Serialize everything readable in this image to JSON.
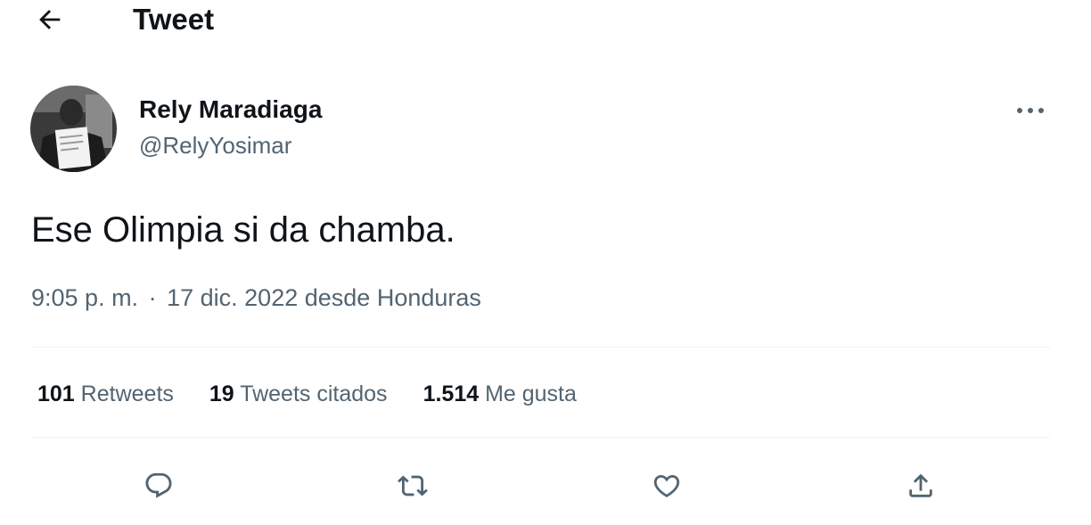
{
  "header": {
    "title": "Tweet",
    "back_icon": "arrow-left-icon"
  },
  "author": {
    "display_name": "Rely Maradiaga",
    "handle": "@RelyYosimar",
    "avatar": "profile-photo"
  },
  "tweet": {
    "text": "Ese Olimpia si da chamba.",
    "time": "9:05 p. m.",
    "separator": "·",
    "date": "17 dic. 2022",
    "location": "desde Honduras"
  },
  "stats": [
    {
      "value": "101",
      "label": "Retweets"
    },
    {
      "value": "19",
      "label": "Tweets citados"
    },
    {
      "value": "1.514",
      "label": "Me gusta"
    }
  ],
  "actions": {
    "reply_icon": "reply-icon",
    "retweet_icon": "retweet-icon",
    "like_icon": "heart-icon",
    "share_icon": "share-icon"
  },
  "colors": {
    "text_primary": "#0f1419",
    "text_secondary": "#536471",
    "divider": "#eff3f4"
  }
}
